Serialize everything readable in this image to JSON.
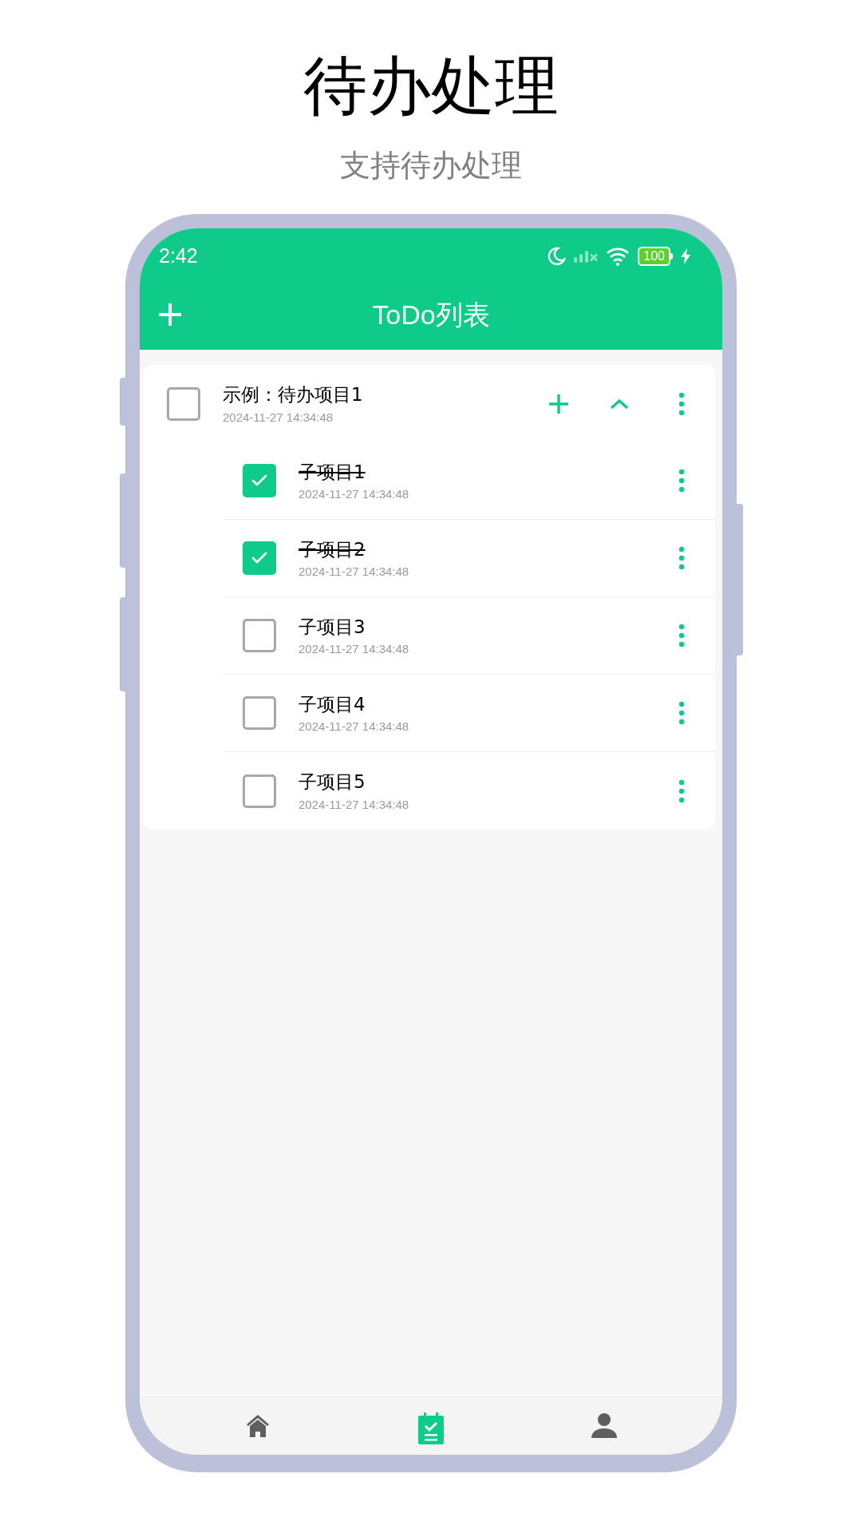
{
  "heading": "待办处理",
  "subtitle": "支持待办处理",
  "status_bar": {
    "time": "2:42",
    "battery": "100"
  },
  "header": {
    "title": "ToDo列表"
  },
  "todo": {
    "title": "示例：待办项目1",
    "date": "2024-11-27 14:34:48",
    "checked": false,
    "expanded": true,
    "children": [
      {
        "title": "子项目1",
        "date": "2024-11-27 14:34:48",
        "checked": true
      },
      {
        "title": "子项目2",
        "date": "2024-11-27 14:34:48",
        "checked": true
      },
      {
        "title": "子项目3",
        "date": "2024-11-27 14:34:48",
        "checked": false
      },
      {
        "title": "子项目4",
        "date": "2024-11-27 14:34:48",
        "checked": false
      },
      {
        "title": "子项目5",
        "date": "2024-11-27 14:34:48",
        "checked": false
      }
    ]
  },
  "bottom_nav": [
    {
      "kind": "home",
      "selected": false
    },
    {
      "kind": "todo",
      "selected": true
    },
    {
      "kind": "profile",
      "selected": false
    }
  ]
}
